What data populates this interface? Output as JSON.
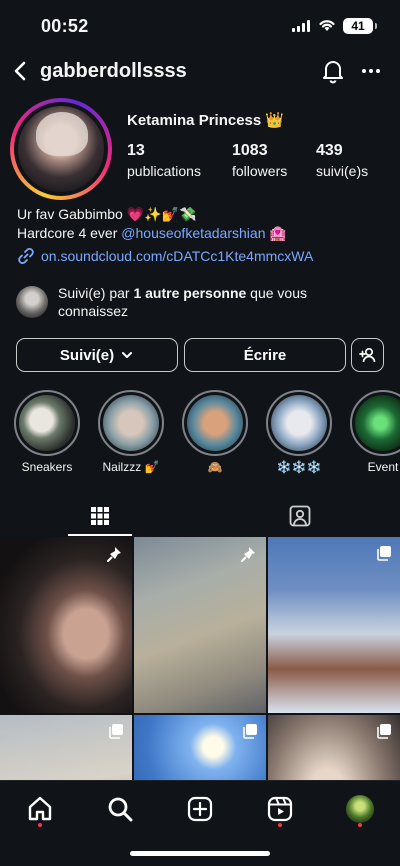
{
  "status_bar": {
    "time": "00:52",
    "battery": "41"
  },
  "header": {
    "username": "gabberdollssss",
    "back_icon": "chevron-left-icon",
    "bell_icon": "bell-icon",
    "more_icon": "more-horizontal-icon"
  },
  "profile": {
    "display_name": "Ketamina Princess 👑",
    "stats": [
      {
        "value": "13",
        "label": "publications"
      },
      {
        "value": "1083",
        "label": "followers"
      },
      {
        "value": "439",
        "label": "suivi(e)s"
      }
    ],
    "bio_line1": "Ur fav Gabbimbo 💗✨💅💸",
    "bio_line2_prefix": "Hardcore 4 ever ",
    "bio_mention": "@houseofketadarshian",
    "bio_line2_suffix": " 🏩",
    "link": "on.soundcloud.com/cDATCc1Kte4mmcxWA",
    "mutual_prefix": "Suivi(e) par ",
    "mutual_bold": "1 autre personne",
    "mutual_suffix": " que vous connaissez"
  },
  "buttons": {
    "follow": "Suivi(e)",
    "message": "Écrire"
  },
  "highlights": [
    {
      "label": "Sneakers"
    },
    {
      "label": "Nailzzz 💅"
    },
    {
      "label": "🙈"
    },
    {
      "label": "❄️❄️❄️"
    },
    {
      "label": "Event"
    }
  ],
  "colors": {
    "background": "#101418",
    "link": "#7aa8ff",
    "notification_dot": "#ff3040"
  }
}
